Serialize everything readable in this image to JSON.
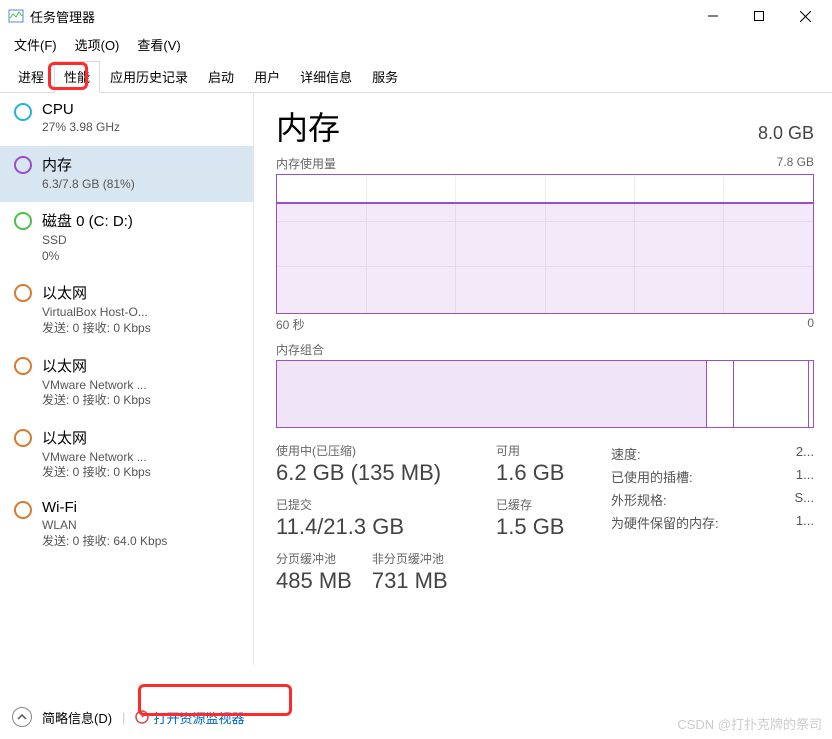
{
  "window": {
    "title": "任务管理器",
    "minimize": "—",
    "maximize": "□",
    "close": "×"
  },
  "menubar": [
    {
      "label": "文件(F)"
    },
    {
      "label": "选项(O)"
    },
    {
      "label": "查看(V)"
    }
  ],
  "tabs": [
    {
      "label": "进程"
    },
    {
      "label": "性能",
      "active": true
    },
    {
      "label": "应用历史记录"
    },
    {
      "label": "启动"
    },
    {
      "label": "用户"
    },
    {
      "label": "详细信息"
    },
    {
      "label": "服务"
    }
  ],
  "sidebar": [
    {
      "name": "CPU",
      "sub": "27% 3.98 GHz",
      "color": "#1fb6d9"
    },
    {
      "name": "内存",
      "sub": "6.3/7.8 GB (81%)",
      "color": "#9b4dca",
      "selected": true
    },
    {
      "name": "磁盘 0 (C: D:)",
      "sub": "SSD\n0%",
      "color": "#4dbf4d"
    },
    {
      "name": "以太网",
      "sub": "VirtualBox Host-O...\n发送: 0 接收: 0 Kbps",
      "color": "#d97a2c"
    },
    {
      "name": "以太网",
      "sub": "VMware Network ...\n发送: 0 接收: 0 Kbps",
      "color": "#d97a2c"
    },
    {
      "name": "以太网",
      "sub": "VMware Network ...\n发送: 0 接收: 0 Kbps",
      "color": "#d97a2c"
    },
    {
      "name": "Wi-Fi",
      "sub": "WLAN\n发送: 0 接收: 64.0 Kbps",
      "color": "#d97a2c"
    }
  ],
  "main": {
    "title": "内存",
    "capacity": "8.0 GB",
    "chart1": {
      "label": "内存使用量",
      "max": "7.8 GB",
      "axisLeft": "60 秒",
      "axisRight": "0"
    },
    "chart2": {
      "label": "内存组合"
    },
    "stats": {
      "inuse_label": "使用中(已压缩)",
      "inuse_val": "6.2 GB (135 MB)",
      "avail_label": "可用",
      "avail_val": "1.6 GB",
      "committed_label": "已提交",
      "committed_val": "11.4/21.3 GB",
      "cached_label": "已缓存",
      "cached_val": "1.5 GB",
      "paged_label": "分页缓冲池",
      "paged_val": "485 MB",
      "nonpaged_label": "非分页缓冲池",
      "nonpaged_val": "731 MB"
    },
    "details": [
      {
        "k": "速度:",
        "v": "2..."
      },
      {
        "k": "已使用的插槽:",
        "v": "1..."
      },
      {
        "k": "外形规格:",
        "v": "S..."
      },
      {
        "k": "为硬件保留的内存:",
        "v": "1..."
      }
    ]
  },
  "footer": {
    "brief": "简略信息(D)",
    "link": "打开资源监视器"
  },
  "watermark": "CSDN @打扑克牌的祭司",
  "chart_data": {
    "type": "line",
    "title": "内存使用量",
    "x_seconds": [
      60,
      55,
      50,
      45,
      40,
      35,
      30,
      25,
      20,
      15,
      10,
      5,
      0
    ],
    "values_gb": [
      6.3,
      6.3,
      6.3,
      6.3,
      6.3,
      6.3,
      6.3,
      6.3,
      6.3,
      6.3,
      6.3,
      6.3,
      6.3
    ],
    "ylim": [
      0,
      7.8
    ],
    "xlabel": "60 秒",
    "ylabel": "GB",
    "composition_pct": {
      "in_use": 80,
      "modified": 5,
      "standby": 14,
      "free": 1
    }
  }
}
